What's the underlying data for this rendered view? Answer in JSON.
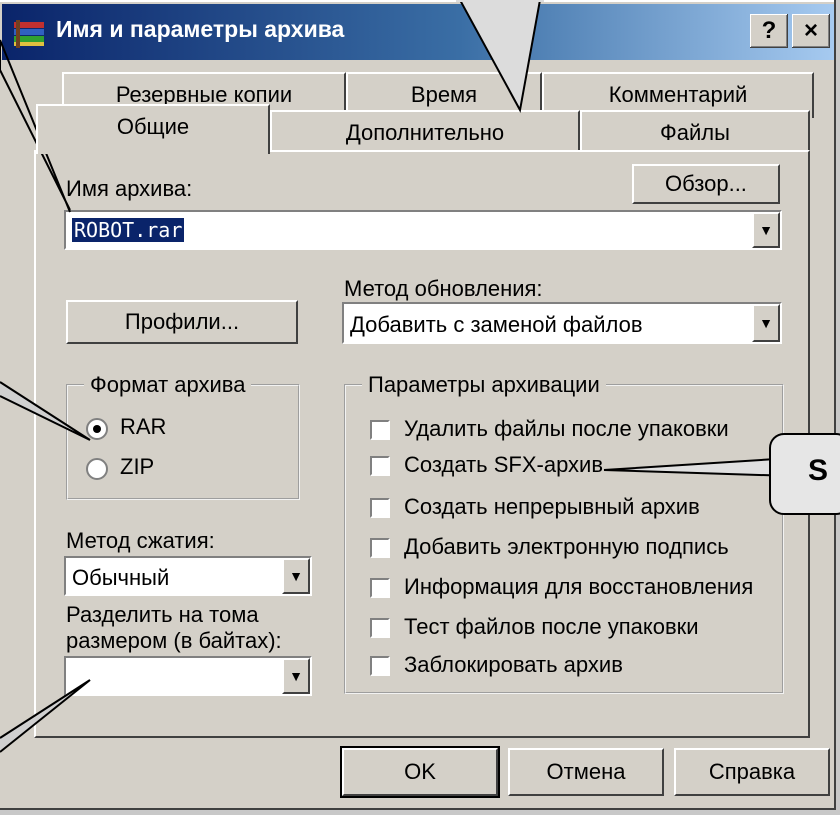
{
  "window": {
    "title": "Имя и параметры архива",
    "help_btn": "?",
    "close_btn": "×"
  },
  "tabs_row1": [
    "Резервные копии",
    "Время",
    "Комментарий"
  ],
  "tabs_row2": [
    "Общие",
    "Дополнительно",
    "Файлы"
  ],
  "archive": {
    "label": "Имя архива:",
    "value": "ROBOT.rar",
    "browse": "Обзор..."
  },
  "profiles_btn": "Профили...",
  "update_method": {
    "label": "Метод обновления:",
    "value": "Добавить с заменой файлов"
  },
  "format": {
    "title": "Формат архива",
    "options": [
      "RAR",
      "ZIP"
    ],
    "selected": "RAR"
  },
  "compression": {
    "label": "Метод сжатия:",
    "value": "Обычный"
  },
  "split": {
    "label1": "Разделить на тома",
    "label2": "размером (в байтах):",
    "value": ""
  },
  "params": {
    "title": "Параметры архивации",
    "items": [
      "Удалить файлы после упаковки",
      "Создать SFX-архив",
      "Создать непрерывный архив",
      "Добавить электронную подпись",
      "Информация для восстановления",
      "Тест файлов после упаковки",
      "Заблокировать архив"
    ]
  },
  "buttons": {
    "ok": "OK",
    "cancel": "Отмена",
    "help": "Справка"
  },
  "callout": {
    "text": "S"
  }
}
